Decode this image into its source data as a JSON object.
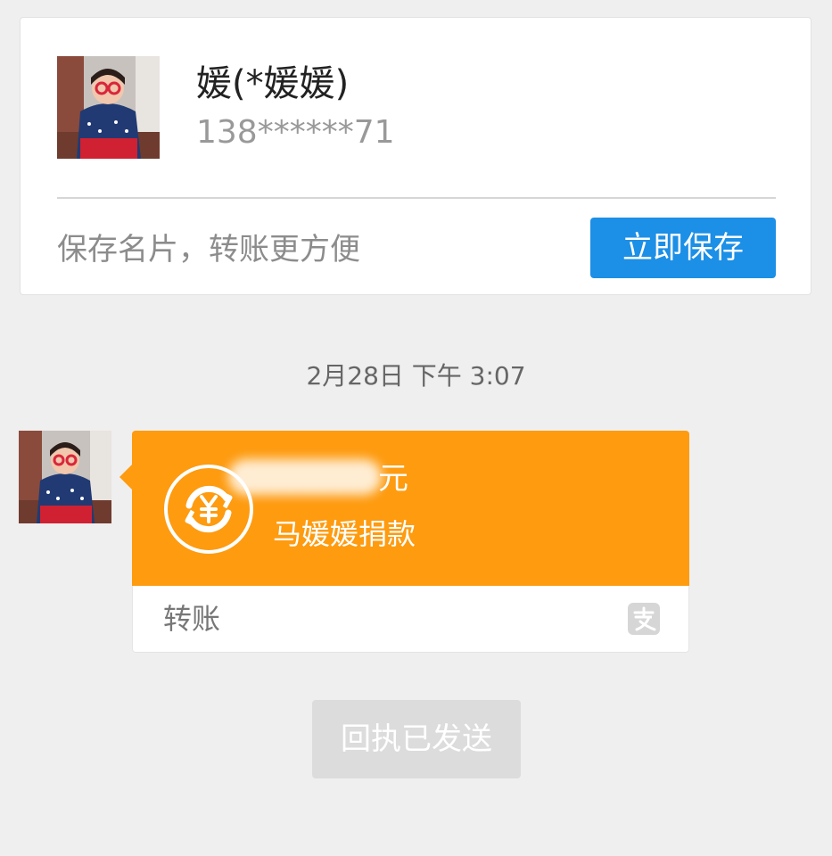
{
  "contact_card": {
    "name": "媛(*媛媛)",
    "phone": "138******71",
    "tip": "保存名片，转账更方便",
    "save_button": "立即保存"
  },
  "chat": {
    "timestamp": "2月28日 下午 3:07",
    "transfer": {
      "amount_unit": "元",
      "description": "马媛媛捐款",
      "label": "转账"
    },
    "receipt_button": "回执已发送"
  },
  "colors": {
    "accent_blue": "#1c8fe6",
    "transfer_orange": "#fe9b0f",
    "background": "#efefef"
  },
  "icons": {
    "transfer": "yuan-refresh-icon",
    "brand": "alipay-icon"
  }
}
